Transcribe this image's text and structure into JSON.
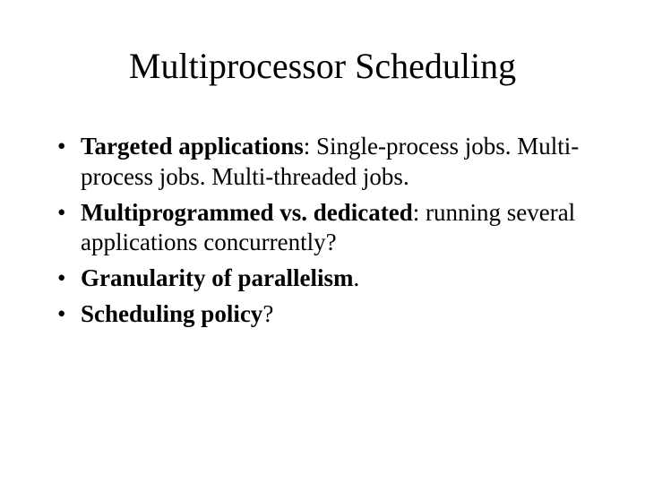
{
  "title": "Multiprocessor Scheduling",
  "bullets": [
    {
      "bold": "Targeted applications",
      "rest": ": Single-process jobs. Multi-process jobs. Multi-threaded jobs."
    },
    {
      "bold": "Multiprogrammed vs. dedicated",
      "rest": ":  running several applications concurrently?"
    },
    {
      "bold": "Granularity of parallelism",
      "rest": "."
    },
    {
      "bold": "Scheduling policy",
      "rest": "?"
    }
  ]
}
